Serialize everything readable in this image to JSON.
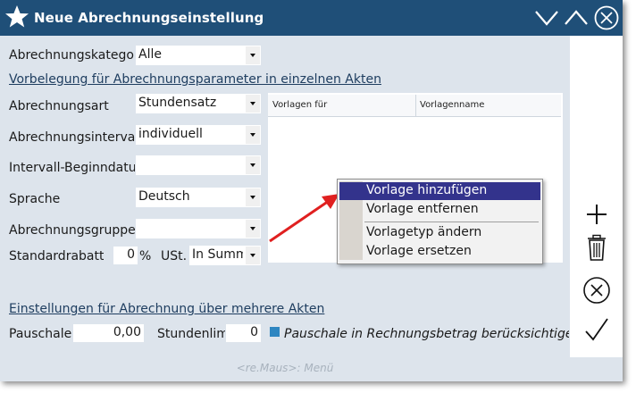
{
  "window": {
    "title": "Neue Abrechnungseinstellung"
  },
  "form": {
    "kategorie_label": "Abrechnungskategorie",
    "kategorie_value": "Alle",
    "vorbelegung_link": "Vorbelegung für Abrechnungsparameter in einzelnen Akten",
    "art_label": "Abrechnungsart",
    "art_value": "Stundensatz",
    "intervall_label": "Abrechnungsintervall",
    "intervall_value": "individuell",
    "beginn_label": "Intervall-Beginndatum",
    "beginn_value": "",
    "sprache_label": "Sprache",
    "sprache_value": "Deutsch",
    "gruppe_label": "Abrechnungsgruppe",
    "gruppe_value": "",
    "rabatt_label": "Standardrabatt",
    "rabatt_value": "0",
    "rabatt_unit": "%",
    "ust_label": "USt.",
    "ust_value": "In Summe",
    "mehrere_link": "Einstellungen für Abrechnung über mehrere Akten",
    "pauschale_label": "Pauschale",
    "pauschale_value": "0,00",
    "stundenlimit_label": "Stundenlimit",
    "stundenlimit_value": "0",
    "checkbox_label": "Pauschale in Rechnungsbetrag berücksichtigen"
  },
  "grid": {
    "columns": [
      "Vorlagen für",
      "Vorlagenname"
    ]
  },
  "context_menu": {
    "items": [
      "Vorlage hinzufügen",
      "Vorlage entfernen",
      "Vorlagetyp ändern",
      "Vorlage ersetzen"
    ]
  },
  "status": {
    "hint": "<re.Maus>: Menü"
  },
  "colors": {
    "titlebar": "#1f4f78",
    "background": "#dde4ec",
    "highlight": "#33338c",
    "link": "#1f3e60",
    "checkbox": "#2e86c1",
    "arrow": "#e02020"
  }
}
